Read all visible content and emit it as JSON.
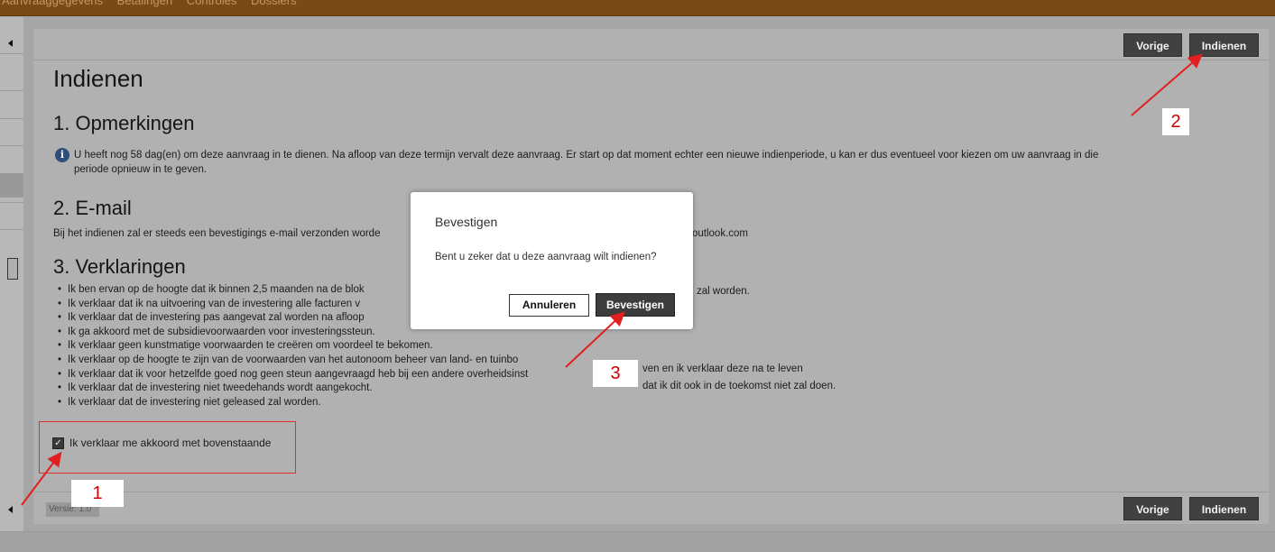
{
  "topbar": {
    "tabs": [
      "Aanvraaggegevens",
      "Betalingen",
      "Controles",
      "Dossiers"
    ]
  },
  "nav": {
    "previous_label": "Vorige",
    "submit_label": "Indienen"
  },
  "page": {
    "title": "Indienen",
    "section1_title": "1. Opmerkingen",
    "section1_info": "U heeft nog 58 dag(en) om deze aanvraag in te dienen. Na afloop van deze termijn vervalt deze aanvraag. Er start op dat moment echter een nieuwe indienperiode, u kan er dus eventueel voor kiezen om uw aanvraag in die",
    "section1_info_cont": "periode opnieuw in te geven.",
    "section2_title": "2. E-mail",
    "section2_text_a": "Bij het indienen zal er steeds een bevestigings e-mail verzonden worde",
    "section2_text_b": "outlook.com",
    "section3_title": "3. Verklaringen",
    "declarations": [
      "Ik ben ervan op de hoogte dat ik binnen 2,5 maanden na de blok",
      "Ik verklaar dat ik na uitvoering van de investering alle facturen v",
      "Ik verklaar dat de investering pas aangevat zal worden na afloop",
      "Ik ga akkoord met de subsidievoorwaarden voor investeringssteun.",
      "Ik verklaar geen kunstmatige voorwaarden te creëren om voordeel te bekomen.",
      "Ik verklaar op de hoogte te zijn van de voorwaarden van het autonoom beheer van land- en tuinbo",
      "Ik verklaar dat ik voor hetzelfde goed nog geen steun aangevraagd heb bij een andere overheidsinst",
      "Ik verklaar dat de investering niet tweedehands wordt aangekocht.",
      "Ik verklaar dat de investering niet geleased zal worden."
    ],
    "declaration_tails": {
      "line1": "zal worden.",
      "line6": "ven en ik verklaar deze na te leven",
      "line7": "dat ik dit ook in de toekomst niet zal doen."
    },
    "agree_label": "Ik verklaar me akkoord met bovenstaande",
    "agree_checked": true,
    "version": "Versie: 1.0"
  },
  "dialog": {
    "title": "Bevestigen",
    "message": "Bent u zeker dat u deze aanvraag wilt indienen?",
    "cancel_label": "Annuleren",
    "confirm_label": "Bevestigen"
  },
  "annotations": {
    "n1": "1",
    "n2": "2",
    "n3": "3",
    "color": "#e02020"
  }
}
